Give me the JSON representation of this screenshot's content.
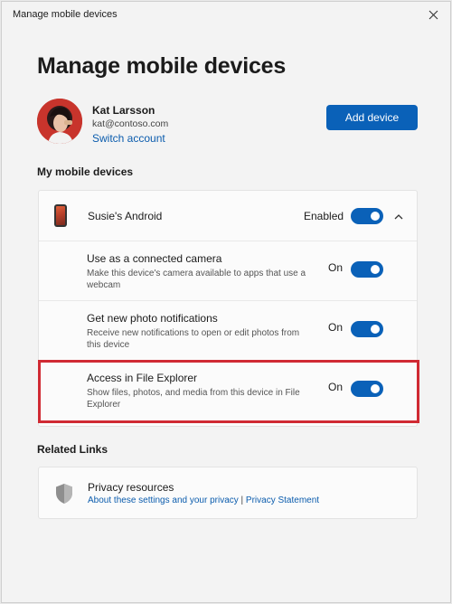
{
  "window": {
    "title": "Manage mobile devices",
    "close_icon": "close-icon"
  },
  "page": {
    "title": "Manage mobile devices"
  },
  "account": {
    "name": "Kat Larsson",
    "email": "kat@contoso.com",
    "switch_label": "Switch account",
    "add_device_label": "Add device"
  },
  "devices_section": {
    "title": "My mobile devices",
    "device": {
      "name": "Susie's Android",
      "status_label": "Enabled",
      "enabled": true,
      "settings": [
        {
          "title": "Use as a connected camera",
          "description": "Make this device's camera available to apps that use a webcam",
          "state_label": "On",
          "on": true
        },
        {
          "title": "Get new photo notifications",
          "description": "Receive new notifications to open or edit photos from this device",
          "state_label": "On",
          "on": true
        },
        {
          "title": "Access in File Explorer",
          "description": "Show files, photos, and media from this device in File Explorer",
          "state_label": "On",
          "on": true
        }
      ]
    }
  },
  "related_links": {
    "title": "Related Links",
    "item_title": "Privacy resources",
    "link_about": "About these settings and your privacy",
    "separator": " | ",
    "link_statement": "Privacy Statement"
  },
  "colors": {
    "accent": "#0a61b8",
    "highlight": "#d02a33",
    "link": "#0b5cad"
  }
}
